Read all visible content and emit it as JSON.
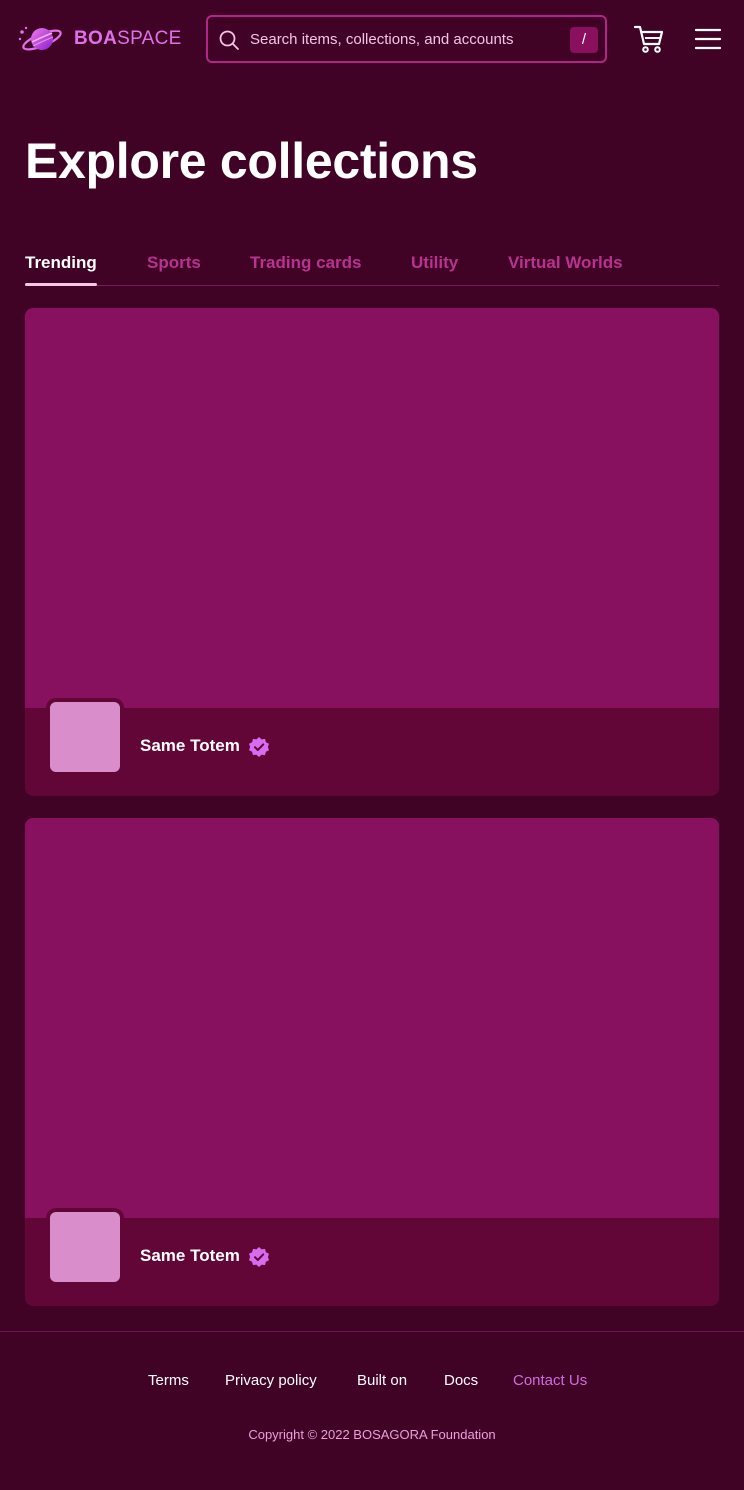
{
  "brand": {
    "name_bold": "BOA",
    "name_light": "SPACE",
    "accent": "#e070e8"
  },
  "search": {
    "placeholder": "Search items, collections, and accounts",
    "shortcut": "/"
  },
  "header_icons": [
    "cart-icon",
    "hamburger-menu-icon"
  ],
  "page": {
    "title": "Explore collections"
  },
  "tabs": [
    {
      "label": "Trending",
      "active": true
    },
    {
      "label": "Sports",
      "active": false
    },
    {
      "label": "Trading cards",
      "active": false
    },
    {
      "label": "Utility",
      "active": false
    },
    {
      "label": "Virtual Worlds",
      "active": false
    }
  ],
  "collections": [
    {
      "name": "Same Totem",
      "verified": true
    },
    {
      "name": "Same Totem",
      "verified": true
    }
  ],
  "footer": {
    "links": [
      {
        "label": "Terms"
      },
      {
        "label": "Privacy policy"
      },
      {
        "label": "Built on"
      },
      {
        "label": "Docs"
      },
      {
        "label": "Contact Us"
      }
    ],
    "copyright": "Copyright © 2022 BOSAGORA Foundation"
  },
  "colors": {
    "background": "#400225",
    "card_banner": "#88115f",
    "card_footer": "#620638",
    "avatar": "#d98ecb",
    "tab_inactive": "#b8338f",
    "verified": "#d86cf0"
  }
}
